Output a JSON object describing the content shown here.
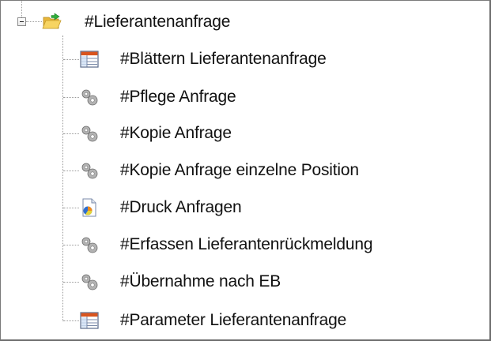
{
  "tree": {
    "root": {
      "label": "#Lieferantenanfrage",
      "icon": "folder-open-icon",
      "expanded": true
    },
    "items": [
      {
        "label": "#Blättern Lieferantenanfrage",
        "icon": "table-icon"
      },
      {
        "label": "#Pflege Anfrage",
        "icon": "gears-icon"
      },
      {
        "label": "#Kopie Anfrage",
        "icon": "gears-icon"
      },
      {
        "label": "#Kopie Anfrage einzelne Position",
        "icon": "gears-icon"
      },
      {
        "label": "#Druck Anfragen",
        "icon": "report-icon"
      },
      {
        "label": "#Erfassen Lieferantenrückmeldung",
        "icon": "gears-icon"
      },
      {
        "label": "#Übernahme nach EB",
        "icon": "gears-icon"
      },
      {
        "label": "#Parameter Lieferantenanfrage",
        "icon": "table-icon"
      }
    ]
  },
  "colors": {
    "connector": "#9a9a9a",
    "folder": "#f2c94c",
    "arrow": "#2fae3a",
    "table_header": "#d9541e",
    "gear": "#a8a8a8",
    "report_pie": "#f08a1c"
  }
}
